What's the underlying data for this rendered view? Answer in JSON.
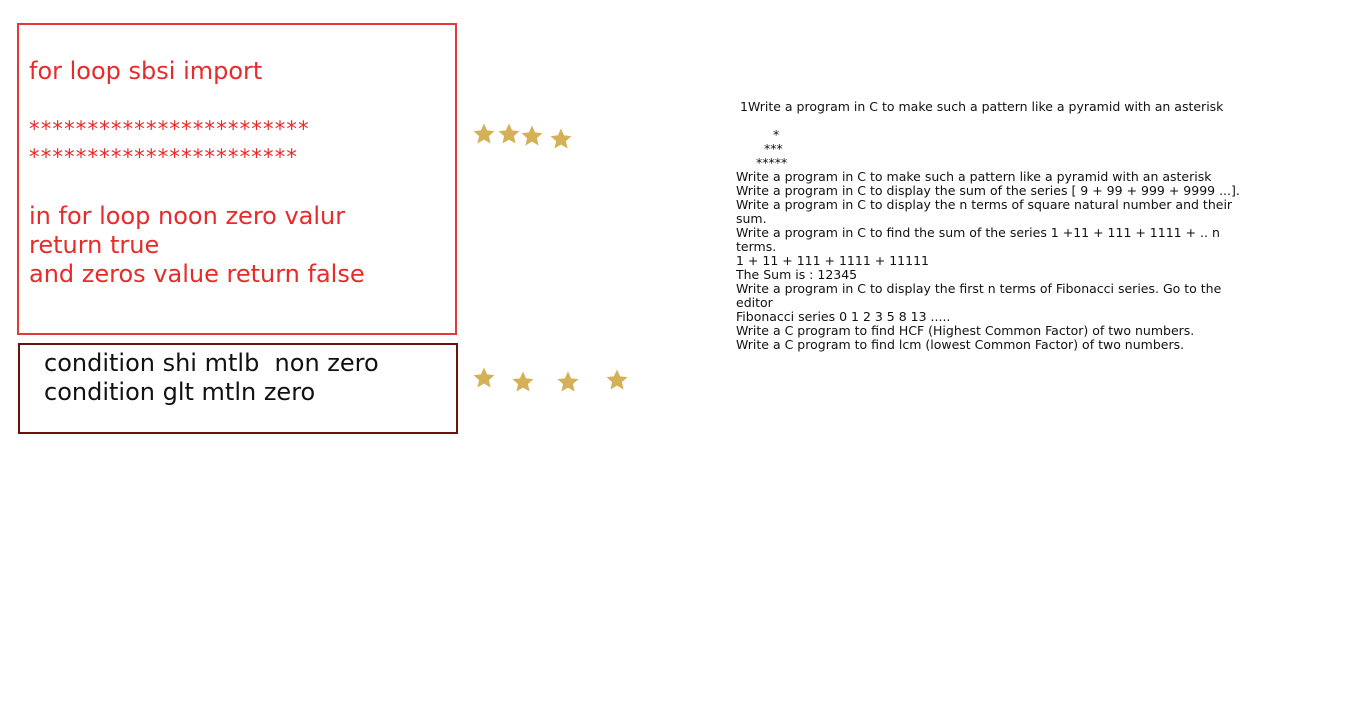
{
  "red_box": {
    "title": "for loop sbsi import",
    "stars_row_1": "************************",
    "stars_row_2": "***********************",
    "rule_1": "in for loop noon zero valur",
    "rule_2": "return true",
    "rule_3": "and zeros value return false"
  },
  "dark_box": {
    "line_1": "condition shi mtlb  non zero",
    "line_2": "condition glt mtln zero"
  },
  "star_color": "#d4b057",
  "star_icon": "star-icon",
  "right_panel": {
    "heading": "1Write a program in C to make such a pattern like a pyramid with an asterisk",
    "pyramid_1": "*",
    "pyramid_2": "***",
    "pyramid_3": "*****",
    "items": [
      "Write a program in C to make such a pattern like a pyramid with an asterisk",
      "Write a program in C to display the sum of the series [ 9 + 99 + 999 + 9999 ...].",
      "Write a program in C to display the n terms of square natural number and their sum.",
      "Write a program in C to find the sum of the series 1 +11 + 111 + 1111 + .. n terms.",
      "1 + 11 + 111 + 1111 + 11111",
      "The Sum is : 12345",
      "Write a program in C to display the first n terms of Fibonacci series. Go to the editor",
      "Fibonacci series 0 1 2 3 5 8 13 .....",
      "Write a C program to find HCF (Highest Common Factor) of two numbers.",
      "Write a C program to find lcm (lowest Common Factor) of two numbers."
    ]
  }
}
